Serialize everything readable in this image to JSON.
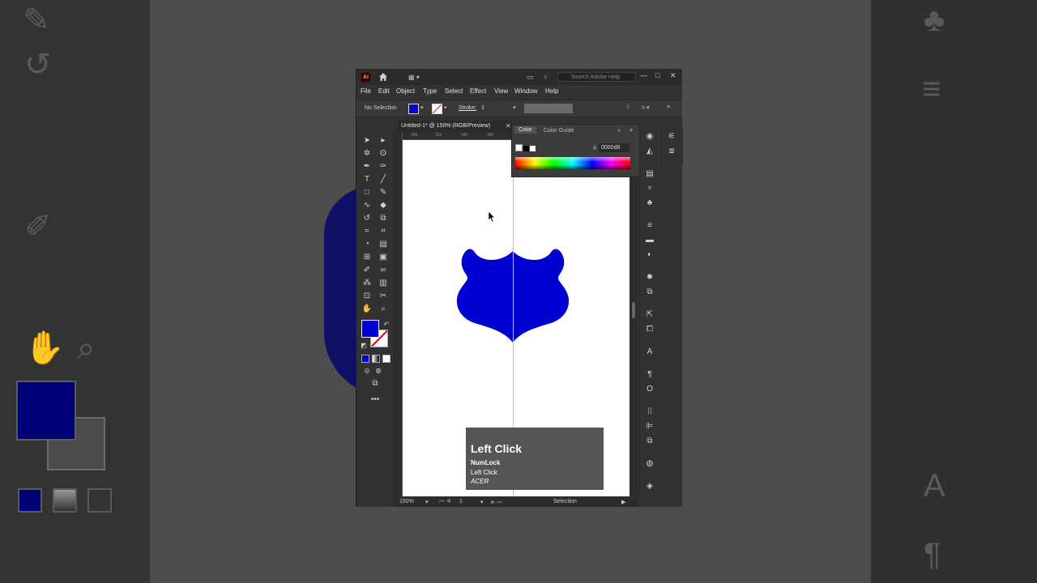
{
  "app": {
    "logo": "Ai",
    "search_placeholder": "Search Adobe Help",
    "window_controls": [
      "—",
      "□",
      "✕"
    ]
  },
  "menu": [
    "File",
    "Edit",
    "Object",
    "Type",
    "Select",
    "Effect",
    "View",
    "Window",
    "Help"
  ],
  "control_bar": {
    "selection_status": "No Selection",
    "stroke_label": "Stroke:",
    "fill_color": "#0000d0"
  },
  "document": {
    "tab_title": "Untitled-1* @ 150% (RGB/Preview)",
    "close": "✕",
    "ruler_ticks": [
      "300",
      "320",
      "340",
      "360"
    ],
    "shape_color": "#0000d0"
  },
  "color_panel": {
    "tabs": [
      "Color",
      "Color Guide"
    ],
    "hex_prefix": "#",
    "hex_value": "0000d8"
  },
  "status_bar": {
    "zoom": "150%",
    "artboard": "1",
    "tool": "Selection"
  },
  "keystroke_overlay": {
    "title": "Left Click",
    "line1": "NumLock",
    "line2": "Left Click",
    "line3": "ACER"
  }
}
